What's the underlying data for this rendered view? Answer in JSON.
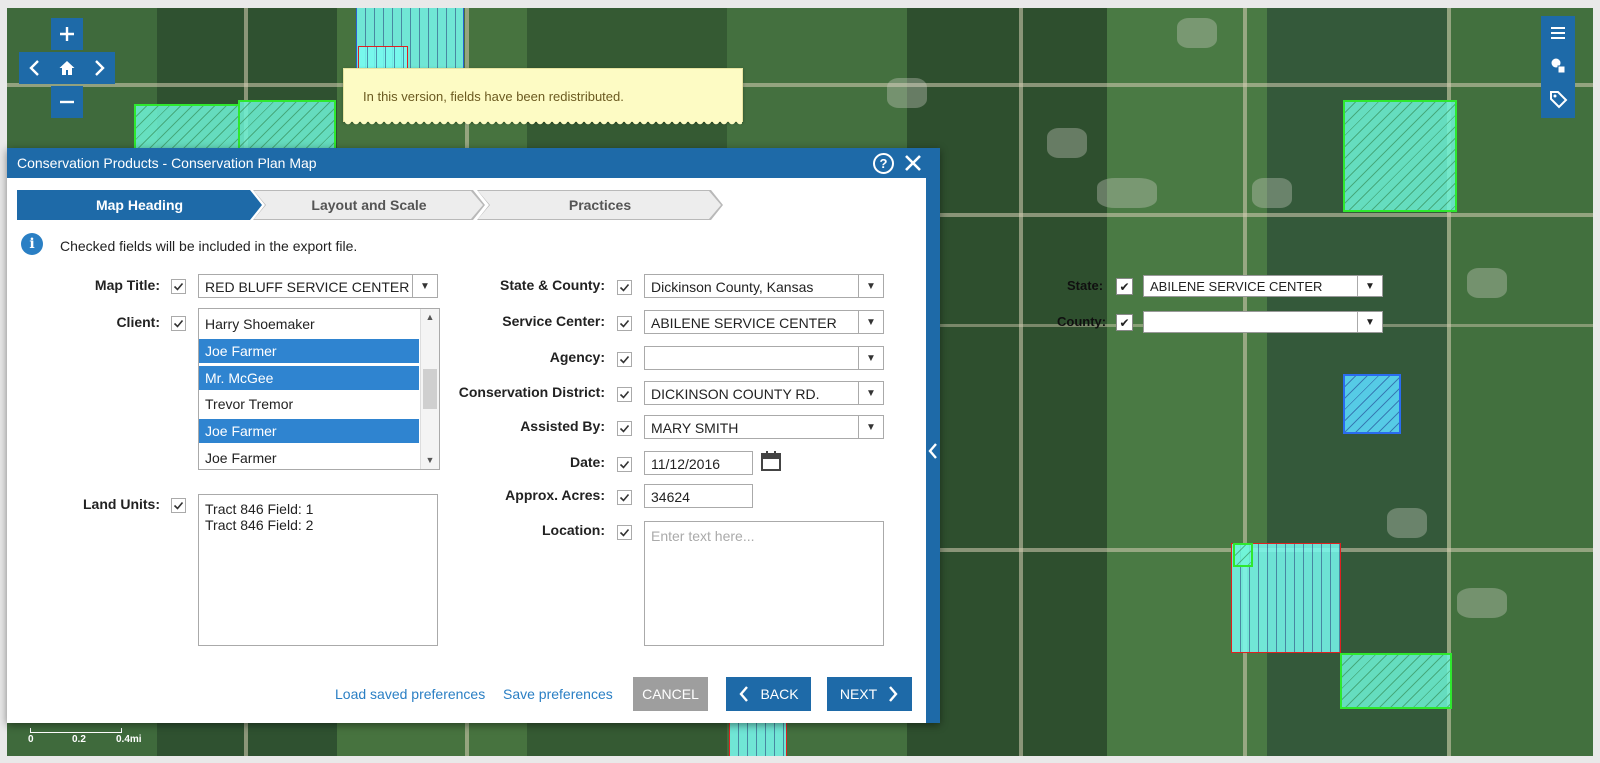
{
  "map": {
    "note": "In this version, fields have been redistributed.",
    "state_label": "State:",
    "state_value": "ABILENE SERVICE CENTER",
    "county_label": "County:",
    "county_value": "",
    "scale_labels": [
      "0",
      "0.2",
      "0.4mi"
    ]
  },
  "nav": {
    "zoom_in": "+",
    "zoom_out": "—"
  },
  "dialog": {
    "title": "Conservation Products - Conservation Plan Map",
    "steps": [
      "Map Heading",
      "Layout and Scale",
      "Practices"
    ],
    "info": "Checked fields will be included in the export file.",
    "map_title_label": "Map Title:",
    "map_title_value": "RED BLUFF SERVICE CENTER",
    "client_label": "Client:",
    "clients": [
      {
        "name": "Harry Shoemaker",
        "selected": false
      },
      {
        "name": "Joe Farmer",
        "selected": true
      },
      {
        "name": "Mr. McGee",
        "selected": true
      },
      {
        "name": "Trevor Tremor",
        "selected": false
      },
      {
        "name": "Joe Farmer",
        "selected": true
      },
      {
        "name": "Joe Farmer",
        "selected": false
      }
    ],
    "land_units_label": "Land Units:",
    "land_units": [
      "Tract 846 Field: 1",
      "Tract 846 Field: 2"
    ],
    "state_county_label": "State & County:",
    "state_county_value": "Dickinson County, Kansas",
    "service_center_label": "Service Center:",
    "service_center_value": "ABILENE SERVICE CENTER",
    "agency_label": "Agency:",
    "agency_value": "",
    "district_label": "Conservation District:",
    "district_value": "DICKINSON COUNTY RD.",
    "assisted_label": "Assisted By:",
    "assisted_value": "MARY SMITH",
    "date_label": "Date:",
    "date_value": "11/12/2016",
    "acres_label": "Approx. Acres:",
    "acres_value": "34624",
    "location_label": "Location:",
    "location_placeholder": "Enter text here...",
    "load_prefs": "Load saved preferences",
    "save_prefs": "Save preferences",
    "cancel": "CANCEL",
    "back": "BACK",
    "next": "NEXT"
  },
  "colors": {
    "accent": "#1e6aa8",
    "selected_row": "#2f84d0",
    "link": "#2a7fc4",
    "note_bg": "#fdfbc4"
  },
  "icons": [
    "plus-icon",
    "minus-icon",
    "home-icon",
    "chevron-left-icon",
    "chevron-right-icon",
    "menu-icon",
    "layers-icon",
    "tag-icon",
    "help-icon",
    "close-icon",
    "info-icon",
    "calendar-icon",
    "checkmark-icon"
  ]
}
